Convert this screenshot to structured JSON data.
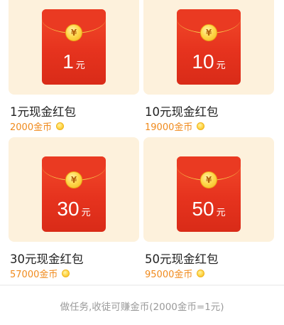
{
  "coin_symbol": "¥",
  "colors": {
    "tile_bg": "#fdf1dc",
    "envelope_red": "#e6331e",
    "coin_gold": "#ffd84d",
    "price_orange": "#f08a1c",
    "footer_gray": "#9a9a9a"
  },
  "cards": [
    {
      "amount": "1",
      "unit": "元",
      "title": "1元现金红包",
      "price": "2000金币",
      "icon": "coin-icon"
    },
    {
      "amount": "10",
      "unit": "元",
      "title": "10元现金红包",
      "price": "19000金币",
      "icon": "coin-icon"
    },
    {
      "amount": "30",
      "unit": "元",
      "title": "30元现金红包",
      "price": "57000金币",
      "icon": "coin-icon"
    },
    {
      "amount": "50",
      "unit": "元",
      "title": "50元现金红包",
      "price": "95000金币",
      "icon": "coin-icon"
    }
  ],
  "footer": {
    "text": "做任务,收徒可赚金币(2000金币=1元)"
  }
}
